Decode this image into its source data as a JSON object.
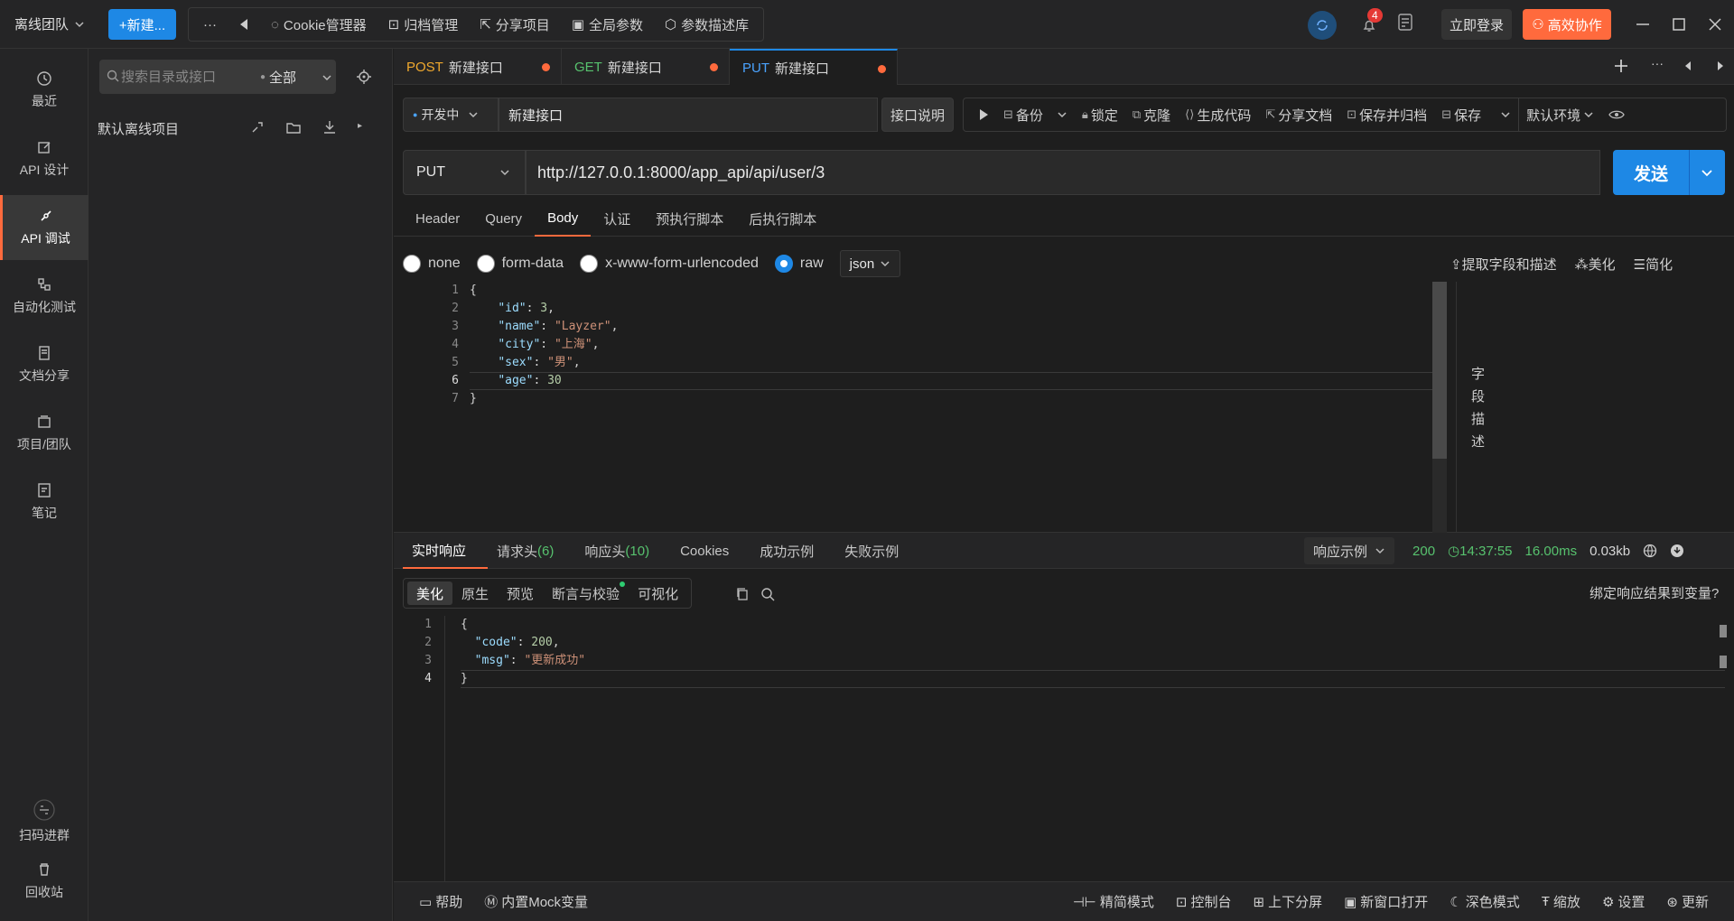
{
  "topbar": {
    "team": "离线团队",
    "new_btn": "+新建...",
    "more": "···",
    "tools": [
      "Cookie管理器",
      "归档管理",
      "分享项目",
      "全局参数",
      "参数描述库"
    ],
    "notif_count": "4",
    "login": "立即登录",
    "collab": "高效协作"
  },
  "rail": {
    "items": [
      "最近",
      "API 设计",
      "API 调试",
      "自动化测试",
      "文档分享",
      "项目/团队",
      "笔记"
    ],
    "scan": "扫码进群",
    "trash": "回收站"
  },
  "tree": {
    "search_placeholder": "搜索目录或接口",
    "scope": "全部",
    "project": "默认离线项目"
  },
  "tabs": [
    {
      "method": "POST",
      "title": "新建接口",
      "color": "#f0a92e"
    },
    {
      "method": "GET",
      "title": "新建接口",
      "color": "#57c26e"
    },
    {
      "method": "PUT",
      "title": "新建接口",
      "color": "#4aa3ff"
    }
  ],
  "request": {
    "status": "开发中",
    "name": "新建接口",
    "desc_btn": "接口说明",
    "actions": [
      "备份",
      "锁定",
      "克隆",
      "生成代码",
      "分享文档",
      "保存并归档",
      "保存"
    ],
    "env": "默认环境",
    "method": "PUT",
    "url": "http://127.0.0.1:8000/app_api/api/user/3",
    "send": "发送",
    "tabs": [
      "Header",
      "Query",
      "Body",
      "认证",
      "预执行脚本",
      "后执行脚本"
    ],
    "body_types": [
      "none",
      "form-data",
      "x-www-form-urlencoded",
      "raw"
    ],
    "raw_format": "json",
    "body_actions": [
      "提取字段和描述",
      "美化",
      "简化"
    ],
    "field_desc": [
      "字",
      "段",
      "描",
      "述"
    ]
  },
  "response": {
    "tabs": [
      "实时响应",
      "请求头",
      "响应头",
      "Cookies",
      "成功示例",
      "失败示例"
    ],
    "req_header_count": "(6)",
    "resp_header_count": "(10)",
    "example_sel": "响应示例",
    "status": "200",
    "time": "14:37:55",
    "duration": "16.00ms",
    "size": "0.03kb",
    "view_tabs": [
      "美化",
      "原生",
      "预览",
      "断言与校验",
      "可视化"
    ],
    "bind": "绑定响应结果到变量?"
  },
  "bottombar": {
    "left": [
      "帮助",
      "内置Mock变量"
    ],
    "right": [
      "精简模式",
      "控制台",
      "上下分屏",
      "新窗口打开",
      "深色模式",
      "缩放",
      "设置",
      "更新"
    ]
  }
}
